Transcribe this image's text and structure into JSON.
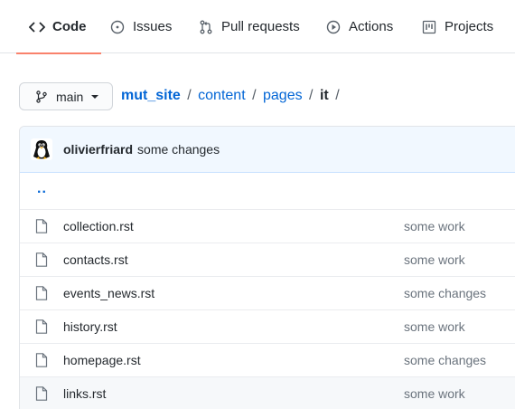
{
  "tabs": {
    "code": {
      "label": "Code",
      "icon": "code-icon"
    },
    "issues": {
      "label": "Issues",
      "icon": "issue-opened-icon"
    },
    "pulls": {
      "label": "Pull requests",
      "icon": "git-pull-request-icon"
    },
    "actions": {
      "label": "Actions",
      "icon": "play-icon"
    },
    "projects": {
      "label": "Projects",
      "icon": "project-icon"
    }
  },
  "branch": {
    "label": "main",
    "icon": "git-branch-icon"
  },
  "breadcrumb": {
    "repo": "mut_site",
    "parts": [
      "content",
      "pages"
    ],
    "current": "it",
    "separator": "/"
  },
  "commit": {
    "author": "olivierfriard",
    "message": "some changes"
  },
  "parent_link": "..",
  "files": [
    {
      "name": "collection.rst",
      "message": "some work"
    },
    {
      "name": "contacts.rst",
      "message": "some work"
    },
    {
      "name": "events_news.rst",
      "message": "some changes"
    },
    {
      "name": "history.rst",
      "message": "some work"
    },
    {
      "name": "homepage.rst",
      "message": "some changes"
    },
    {
      "name": "links.rst",
      "message": "some work"
    }
  ],
  "colors": {
    "link": "#0366d6",
    "selected_tab_underline": "#f9826c",
    "commit_bar_bg": "#f1f8ff",
    "muted_text": "#6a737d"
  }
}
